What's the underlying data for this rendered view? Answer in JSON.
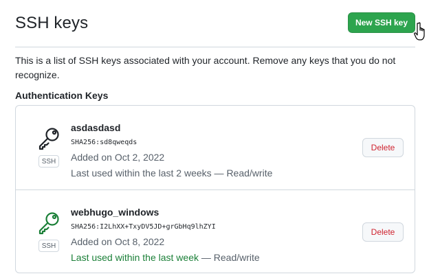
{
  "header": {
    "title": "SSH keys",
    "new_button_label": "New SSH key"
  },
  "description": "This is a list of SSH keys associated with your account. Remove any keys that you do not recognize.",
  "section_title": "Authentication Keys",
  "colors": {
    "primary_button": "#2da44e",
    "danger_text": "#cf222e",
    "active_key_icon": "#1a7f37",
    "inactive_key_icon": "#1f2328",
    "muted_text": "#57606a"
  },
  "keys": [
    {
      "title": "asdasdasd",
      "fingerprint": "SHA256:sd8qweqds",
      "added": "Added on Oct 2, 2022",
      "last_used_highlight": "",
      "last_used_rest": "Last used within the last 2 weeks — Read/write",
      "badge": "SSH",
      "delete_label": "Delete",
      "icon": "key-icon"
    },
    {
      "title": "webhugo_windows",
      "fingerprint": "SHA256:I2LhXX+TxyDV5JD+grGbHq9lhZYI",
      "added": "Added on Oct 8, 2022",
      "last_used_highlight": "Last used within the last week",
      "last_used_rest": " — Read/write",
      "badge": "SSH",
      "delete_label": "Delete",
      "icon": "key-icon"
    }
  ]
}
